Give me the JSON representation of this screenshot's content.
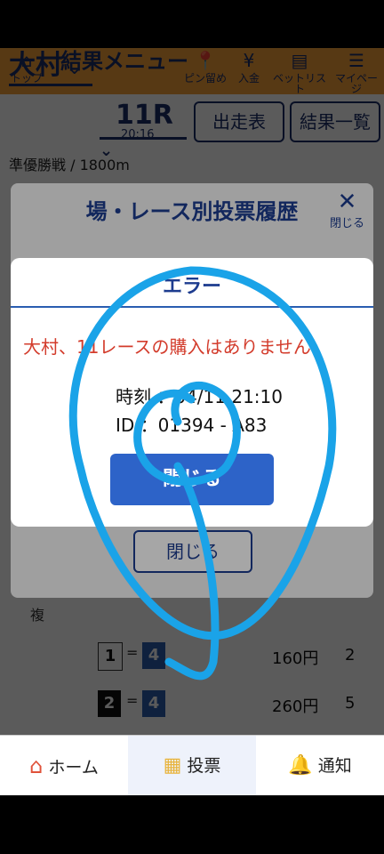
{
  "topnav": {
    "title": "結果メニュー",
    "items": [
      {
        "icon": "home-icon",
        "label": "トップ"
      },
      {
        "icon": "pin-icon",
        "label": "ピン留め"
      },
      {
        "icon": "deposit-icon",
        "label": "入金"
      },
      {
        "icon": "betlist-icon",
        "label": "ベットリスト"
      },
      {
        "icon": "menu-icon",
        "label": "マイページ"
      }
    ]
  },
  "selection": {
    "venue": "大村",
    "race": "11R",
    "time": "20:16",
    "entries_button": "出走表",
    "results_button": "結果一覧",
    "race_sub": "準優勝戦 / 1800m"
  },
  "history_modal": {
    "title": "場・レース別投票履歴",
    "close_small": "閉じる",
    "close_button": "閉じる"
  },
  "error_modal": {
    "title": "エラー",
    "message": "大村、11レースの購入はありません",
    "time_line": "時刻 ：04/11 21:10",
    "id_line": "ID ：01394 - A83",
    "close_button": "閉じる"
  },
  "table": {
    "rows": [
      {
        "label": "複",
        "a": "",
        "b": "",
        "amount": "",
        "rank": ""
      },
      {
        "label": "",
        "a": "1",
        "b": "4",
        "amount": "160円",
        "rank": "2"
      },
      {
        "label": "",
        "a": "2",
        "b": "4",
        "amount": "260円",
        "rank": "5"
      }
    ]
  },
  "bottomnav": {
    "home": "ホーム",
    "vote": "投票",
    "notify": "通知"
  },
  "colors": {
    "accent_orange": "#f5a13b",
    "navy": "#1d2f6b",
    "error_red": "#d33c2c",
    "primary_blue": "#2d63c8",
    "scribble": "#1aa3e8"
  }
}
